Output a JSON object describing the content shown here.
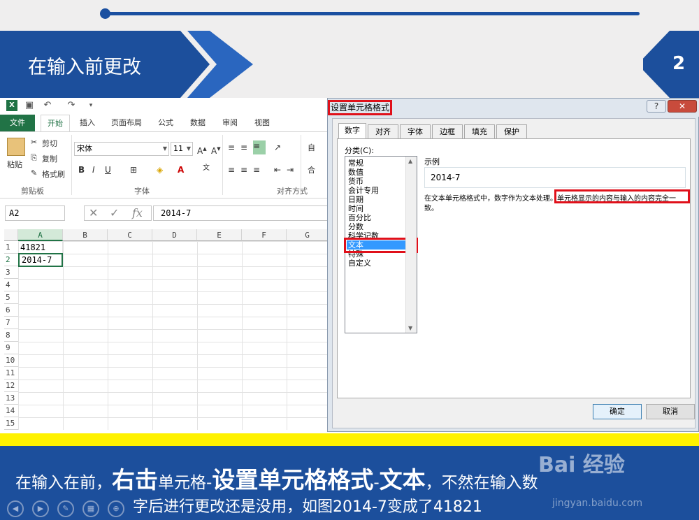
{
  "slide": {
    "title": "在输入前更改",
    "page_number": "2",
    "caption": {
      "part1": "在输入在前，",
      "part2": "右击",
      "part3": "单元格-",
      "part4": "设置单元格格式",
      "part5": "-",
      "part6": "文本",
      "part7": "，不然在输入数",
      "line2": "字后进行更改还是没用，如图2014-7变成了41821"
    },
    "watermark": "Bai 经验",
    "watermark_url": "jingyan.baidu.com",
    "colors": {
      "accent_blue": "#1c4f9c",
      "highlight_yellow": "#fff200",
      "annotation_red": "#e0101a",
      "excel_green": "#217346"
    }
  },
  "excel": {
    "tabs": [
      "文件",
      "开始",
      "插入",
      "页面布局",
      "公式",
      "数据",
      "审阅",
      "视图"
    ],
    "clipboard": {
      "paste": "粘贴",
      "cut": "剪切",
      "copy": "复制",
      "format_painter": "格式刷",
      "group_label": "剪贴板"
    },
    "font": {
      "name": "宋体",
      "size": "11",
      "bold": "B",
      "italic": "I",
      "underline": "U",
      "group_label": "字体"
    },
    "alignment": {
      "group_label": "对齐方式",
      "wrap": "自",
      "merge": "合"
    },
    "name_box": "A2",
    "formula_value": "2014-7",
    "columns": [
      "A",
      "B",
      "C",
      "D",
      "E",
      "F",
      "G"
    ],
    "rows": [
      "1",
      "2",
      "3",
      "4",
      "5",
      "6",
      "7",
      "8",
      "9",
      "10",
      "11",
      "12",
      "13",
      "14",
      "15"
    ],
    "cells": {
      "A1": "41821",
      "A2": "2014-7"
    }
  },
  "dialog": {
    "title": "设置单元格格式",
    "help": "?",
    "close": "✕",
    "tabs": [
      "数字",
      "对齐",
      "字体",
      "边框",
      "填充",
      "保护"
    ],
    "category_label": "分类(C):",
    "categories": [
      "常规",
      "数值",
      "货币",
      "会计专用",
      "日期",
      "时间",
      "百分比",
      "分数",
      "科学记数",
      "文本",
      "特殊",
      "自定义"
    ],
    "selected_category": "文本",
    "sample_label": "示例",
    "sample_value": "2014-7",
    "description_line1_a": "在文本单元格格式中，数字作为文本处理。",
    "description_line1_b": "单元格显示的内容与输入的内容完全一",
    "description_line2": "致。",
    "ok": "确定",
    "cancel": "取消"
  }
}
